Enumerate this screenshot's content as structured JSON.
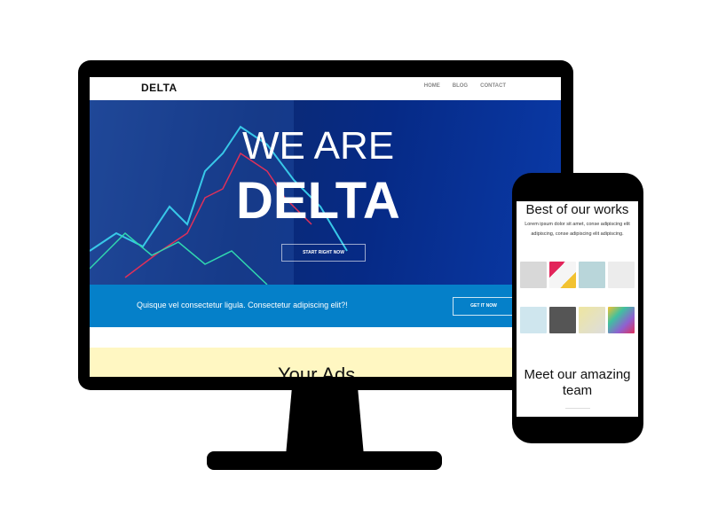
{
  "monitor": {
    "nav": {
      "logo": "DELTA",
      "links": [
        "HOME",
        "BLOG",
        "CONTACT"
      ]
    },
    "hero": {
      "line1": "WE ARE",
      "line2": "DELTA",
      "button": "START RIGHT NOW"
    },
    "band": {
      "text": "Quisque vel consectetur ligula. Consectetur adipiscing elit?!",
      "button": "GET IT NOW"
    },
    "ads": {
      "title": "Your Ads"
    }
  },
  "phone": {
    "works_title": "Best of our works",
    "works_text": "Lorem ipsum dolor sit amet, conse adipiscing elit adipiscing, conse adipiscing elit adipiscing.",
    "team_title": "Meet our amazing team"
  },
  "colors": {
    "band": "#0580c9",
    "hero": "#0b2a75",
    "ads": "#fff7c2"
  }
}
